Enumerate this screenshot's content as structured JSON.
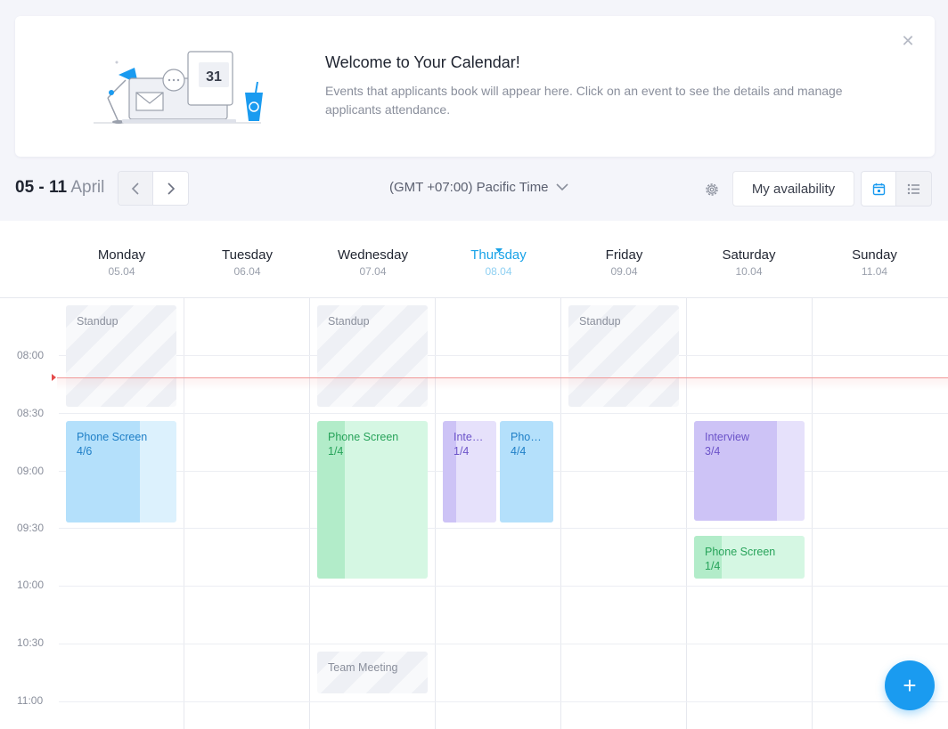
{
  "banner": {
    "title": "Welcome to Your Calendar!",
    "description": "Events that  applicants book will appear here. Click on an event to see the details and manage applicants attendance.",
    "calendar_badge": "31",
    "close_icon": "close-icon"
  },
  "toolbar": {
    "range_days": "05 - 11",
    "range_month": "April",
    "timezone": "(GMT +07:00) Pacific Time",
    "availability_label": "My availability"
  },
  "days": [
    {
      "name": "Monday",
      "date": "05.04"
    },
    {
      "name": "Tuesday",
      "date": "06.04"
    },
    {
      "name": "Wednesday",
      "date": "07.04"
    },
    {
      "name": "Thursday",
      "date": "08.04",
      "today": true
    },
    {
      "name": "Friday",
      "date": "09.04"
    },
    {
      "name": "Saturday",
      "date": "10.04"
    },
    {
      "name": "Sunday",
      "date": "11.04"
    }
  ],
  "times": [
    "08:00",
    "08:30",
    "09:00",
    "09:30",
    "10:00",
    "10:30",
    "11:00"
  ],
  "events": {
    "mon_standup": {
      "title": "Standup"
    },
    "mon_phone": {
      "title": "Phone Screen",
      "count": "4/6",
      "filled": 0.67
    },
    "wed_standup": {
      "title": "Standup"
    },
    "wed_phone": {
      "title": "Phone Screen",
      "count": "1/4",
      "filled": 0.25
    },
    "wed_team": {
      "title": "Team Meeting"
    },
    "thu_interview": {
      "title": "Interv...",
      "count": "1/4",
      "filled": 0.25
    },
    "thu_phone": {
      "title": "Phon...",
      "count": "4/4",
      "filled": 1.0
    },
    "fri_standup": {
      "title": "Standup"
    },
    "sat_interview": {
      "title": "Interview",
      "count": "3/4",
      "filled": 0.75
    },
    "sat_phone": {
      "title": "Phone Screen",
      "count": "1/4",
      "filled": 0.25
    }
  },
  "colors": {
    "accent": "#1a9bf0",
    "now_line": "#e54b4b",
    "blue_event": "#dcf1fd",
    "green_event": "#d5f7e3",
    "purple_event": "#e6e1fb"
  },
  "fab": {
    "label": "+"
  }
}
